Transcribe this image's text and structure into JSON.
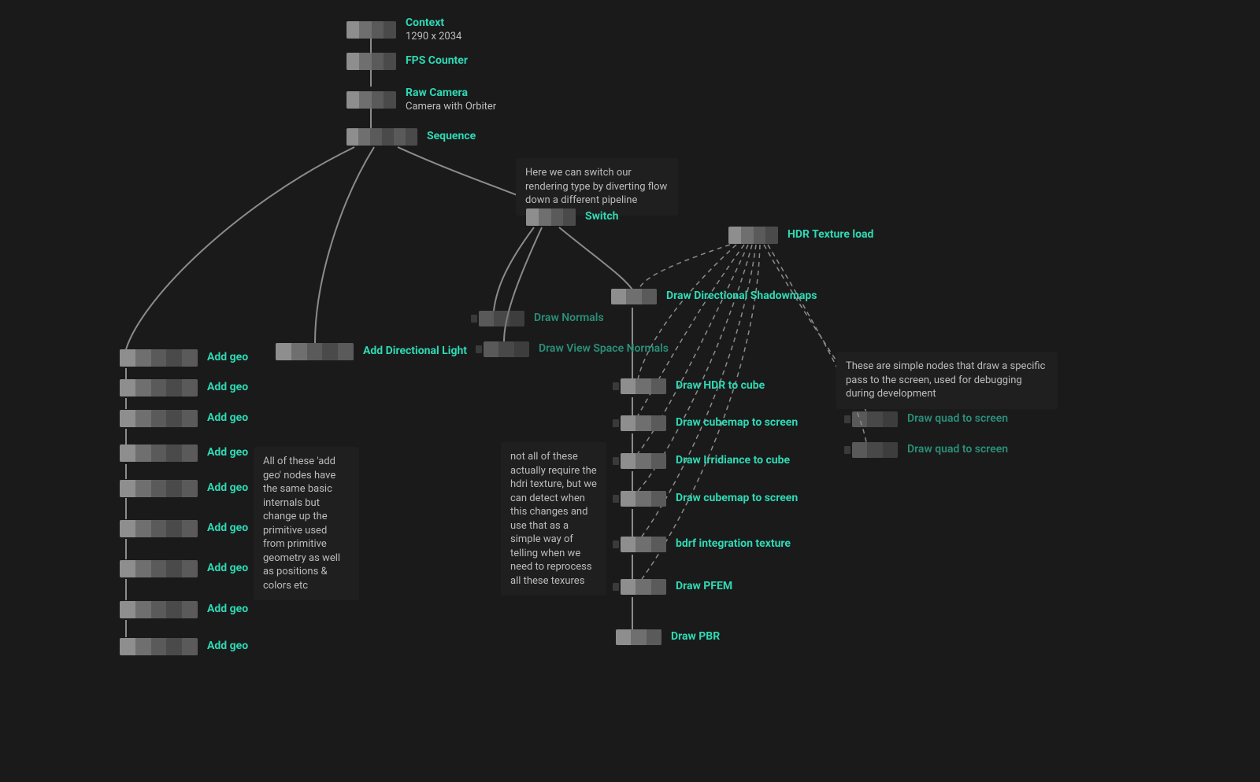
{
  "nodes": {
    "context": {
      "title": "Context",
      "sub": "1290 x 2034"
    },
    "fps": {
      "title": "FPS Counter"
    },
    "rawcam": {
      "title": "Raw Camera",
      "sub": "Camera with Orbiter"
    },
    "sequence": {
      "title": "Sequence"
    },
    "switch": {
      "title": "Switch"
    },
    "hdrload": {
      "title": "HDR Texture load"
    },
    "addlight": {
      "title": "Add Directional Light"
    },
    "shadowmaps": {
      "title": "Draw Directional Shadowmaps"
    },
    "drawnormals": {
      "title": "Draw  Normals"
    },
    "drawvsnormals": {
      "title": "Draw View Space Normals"
    },
    "hdr2cube": {
      "title": "Draw HDR to cube"
    },
    "cube2screen1": {
      "title": "Draw cubemap to screen"
    },
    "irr2cube": {
      "title": "Draw Irridiance to cube"
    },
    "cube2screen2": {
      "title": "Draw cubemap to screen"
    },
    "bdrf": {
      "title": "bdrf integration texture"
    },
    "pfem": {
      "title": "Draw PFEM"
    },
    "pbr": {
      "title": "Draw  PBR"
    },
    "quad1": {
      "title": "Draw quad to screen"
    },
    "quad2": {
      "title": "Draw quad to screen"
    },
    "addgeo0": {
      "title": "Add geo"
    },
    "addgeo1": {
      "title": "Add geo"
    },
    "addgeo2": {
      "title": "Add geo"
    },
    "addgeo3": {
      "title": "Add geo"
    },
    "addgeo4": {
      "title": "Add geo"
    },
    "addgeo5": {
      "title": "Add geo"
    },
    "addgeo6": {
      "title": "Add geo"
    },
    "addgeo7": {
      "title": "Add geo"
    },
    "addgeo8": {
      "title": "Add geo"
    }
  },
  "comments": {
    "switch": "Here we can switch our rendering type by diverting flow down a different pipeline",
    "addgeo": "All of these 'add geo' nodes have the same basic internals but change up the primitive used from primitive geometry as well as positions & colors etc",
    "hdri": "not all of these actually require  the hdri texture, but we can detect when this changes and use that as a simple way of telling when we need to reprocess all these texures",
    "quads": "These are simple nodes that draw a specific pass to the screen, used for debugging during development"
  }
}
